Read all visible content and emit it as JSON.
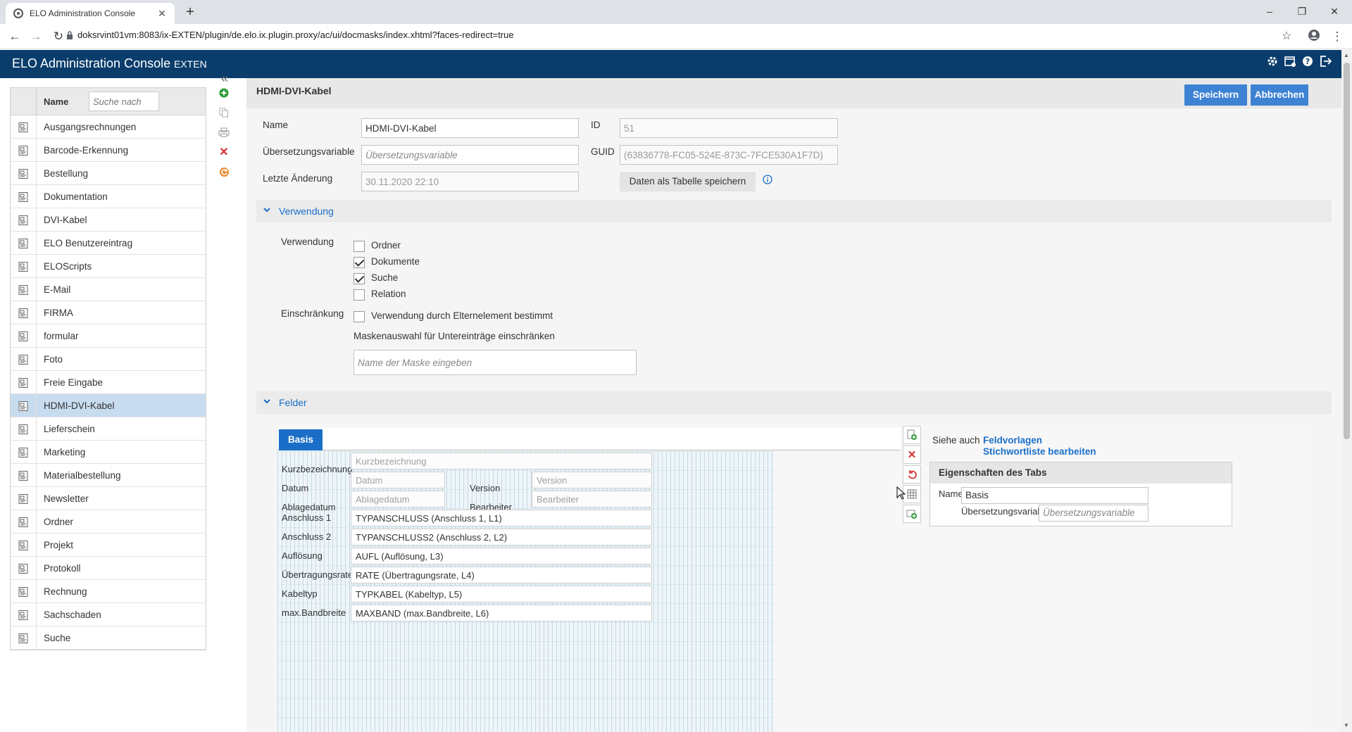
{
  "browser": {
    "tab_title": "ELO Administration Console",
    "tab_close": "✕",
    "new_tab": "+",
    "url": "doksrvint01vm:8083/ix-EXTEN/plugin/de.elo.ix.plugin.proxy/ac/ui/docmasks/index.xhtml?faces-redirect=true",
    "window_controls": [
      "–",
      "❐",
      "✕"
    ]
  },
  "app": {
    "title": "ELO Administration Console",
    "subtitle": "EXTEN"
  },
  "masks": {
    "header_name": "Name",
    "search_placeholder": "Suche nach",
    "items": [
      "Ausgangsrechnungen",
      "Barcode-Erkennung",
      "Bestellung",
      "Dokumentation",
      "DVI-Kabel",
      "ELO Benutzereintrag",
      "ELOScripts",
      "E-Mail",
      "FIRMA",
      "formular",
      "Foto",
      "Freie Eingabe",
      "HDMI-DVI-Kabel",
      "Lieferschein",
      "Marketing",
      "Materialbestellung",
      "Newsletter",
      "Ordner",
      "Projekt",
      "Protokoll",
      "Rechnung",
      "Sachschaden",
      "Suche"
    ],
    "selected": "HDMI-DVI-Kabel"
  },
  "editor": {
    "title": "HDMI-DVI-Kabel",
    "save_label": "Speichern",
    "cancel_label": "Abbrechen",
    "name_label": "Name",
    "name_value": "HDMI-DVI-Kabel",
    "translation_label": "Übersetzungsvariable",
    "translation_placeholder": "Übersetzungsvariable",
    "last_change_label": "Letzte Änderung",
    "last_change_value": "30.11.2020 22:10",
    "id_label": "ID",
    "id_value": "51",
    "guid_label": "GUID",
    "guid_value": "(63836778-FC05-524E-873C-7FCE530A1F7D)",
    "save_table_label": "Daten als Tabelle speichern"
  },
  "usage": {
    "section_title": "Verwendung",
    "label": "Verwendung",
    "options": [
      {
        "label": "Ordner",
        "checked": false
      },
      {
        "label": "Dokumente",
        "checked": true
      },
      {
        "label": "Suche",
        "checked": true
      },
      {
        "label": "Relation",
        "checked": false
      }
    ],
    "restriction_label": "Einschränkung",
    "restriction_option": "Verwendung durch Elternelement bestimmt",
    "mask_select_label": "Maskenauswahl für Untereinträge einschränken",
    "mask_select_placeholder": "Name der Maske eingeben"
  },
  "fields": {
    "section_title": "Felder",
    "tab_label": "Basis",
    "rows": {
      "kurz_label": "Kurzbezeichnung",
      "kurz_value": "Kurzbezeichnung",
      "datum_label": "Datum",
      "datum_value": "Datum",
      "version_label": "Version",
      "version_value": "Version",
      "ablage_label": "Ablagedatum",
      "ablage_value": "Ablagedatum",
      "bearbeiter_label": "Bearbeiter",
      "bearbeiter_value": "Bearbeiter"
    },
    "custom": [
      {
        "label": "Anschluss 1",
        "value": "TYPANSCHLUSS (Anschluss 1, L1)"
      },
      {
        "label": "Anschluss 2",
        "value": "TYPANSCHLUSS2 (Anschluss 2, L2)"
      },
      {
        "label": "Auflösung",
        "value": "AUFL (Auflösung, L3)"
      },
      {
        "label": "Übertragungsrate",
        "value": "RATE (Übertragungsrate, L4)"
      },
      {
        "label": "Kabeltyp",
        "value": "TYPKABEL (Kabeltyp, L5)"
      },
      {
        "label": "max.Bandbreite",
        "value": "MAXBAND (max.Bandbreite, L6)"
      }
    ],
    "see_also_label": "Siehe auch",
    "link_templates": "Feldvorlagen",
    "link_keywords": "Stichwortliste bearbeiten",
    "tab_props_title": "Eigenschaften des Tabs",
    "tab_name_label": "Name",
    "tab_name_value": "Basis",
    "tab_translation_label": "Übersetzungsvariable",
    "tab_translation_placeholder": "Übersetzungsvariable"
  },
  "colors": {
    "header_bg": "#0a3d6b",
    "accent": "#1a6ec8",
    "button": "#3d82d3",
    "selected_row": "#c8dcf0"
  }
}
